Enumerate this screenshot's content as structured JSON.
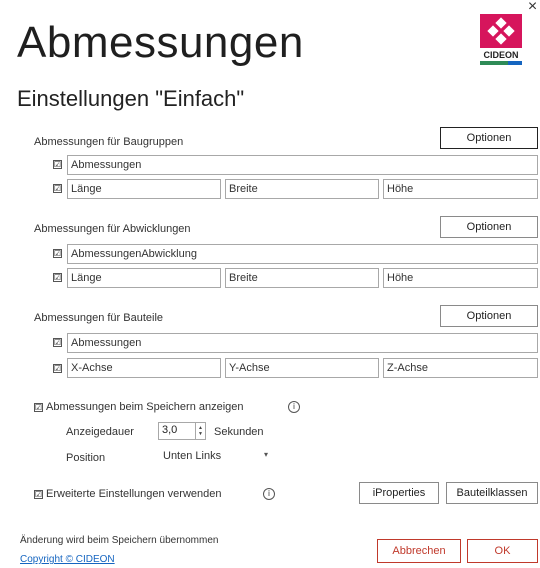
{
  "window": {
    "title": "Abmessungen",
    "subtitle": "Einstellungen \"Einfach\"",
    "close_glyph": "×"
  },
  "logo": {
    "text": "CIDEON",
    "brand_color": "#d6155c",
    "accent_color": "#2e8b57"
  },
  "sections": [
    {
      "label": "Abmessungen für Baugruppen",
      "options_label": "Optionen",
      "row1": {
        "checked": true,
        "value": "Abmessungen"
      },
      "row2": {
        "checked": true,
        "fields": [
          "Länge",
          "Breite",
          "Höhe"
        ]
      }
    },
    {
      "label": "Abmessungen für Abwicklungen",
      "options_label": "Optionen",
      "row1": {
        "checked": true,
        "value": "AbmessungenAbwicklung"
      },
      "row2": {
        "checked": true,
        "fields": [
          "Länge",
          "Breite",
          "Höhe"
        ]
      }
    },
    {
      "label": "Abmessungen für Bauteile",
      "options_label": "Optionen",
      "row1": {
        "checked": true,
        "value": "Abmessungen"
      },
      "row2": {
        "checked": true,
        "fields": [
          "X-Achse",
          "Y-Achse",
          "Z-Achse"
        ]
      }
    }
  ],
  "show_on_save": {
    "checked": true,
    "label": "Abmessungen beim Speichern anzeigen"
  },
  "display_duration": {
    "label": "Anzeigedauer",
    "value": "3,0",
    "unit": "Sekunden"
  },
  "position": {
    "label": "Position",
    "value": "Unten Links"
  },
  "extended": {
    "checked": true,
    "label": "Erweiterte Einstellungen verwenden",
    "iproperties_label": "iProperties",
    "classes_label": "Bauteilklassen"
  },
  "footer": {
    "note": "Änderung wird beim Speichern übernommen",
    "copyright": "Copyright © CIDEON",
    "cancel_label": "Abbrechen",
    "ok_label": "OK"
  },
  "glyphs": {
    "check": "☑",
    "info": "i",
    "spin_up": "▲",
    "spin_down": "▼",
    "dropdown": "▾"
  }
}
